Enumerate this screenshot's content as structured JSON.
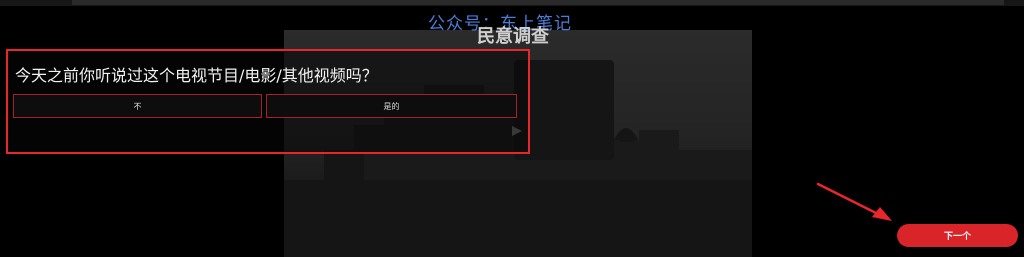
{
  "watermark": "公众号：东上笔记",
  "survey": {
    "title": "民意调查",
    "question": "今天之前你听说过这个电视节目/电影/其他视频吗？",
    "options": [
      {
        "label": "不"
      },
      {
        "label": "是的"
      }
    ],
    "next_label": "下一个"
  },
  "colors": {
    "accent": "#e8262c",
    "watermark": "#4a7fd8",
    "background": "#000000"
  }
}
